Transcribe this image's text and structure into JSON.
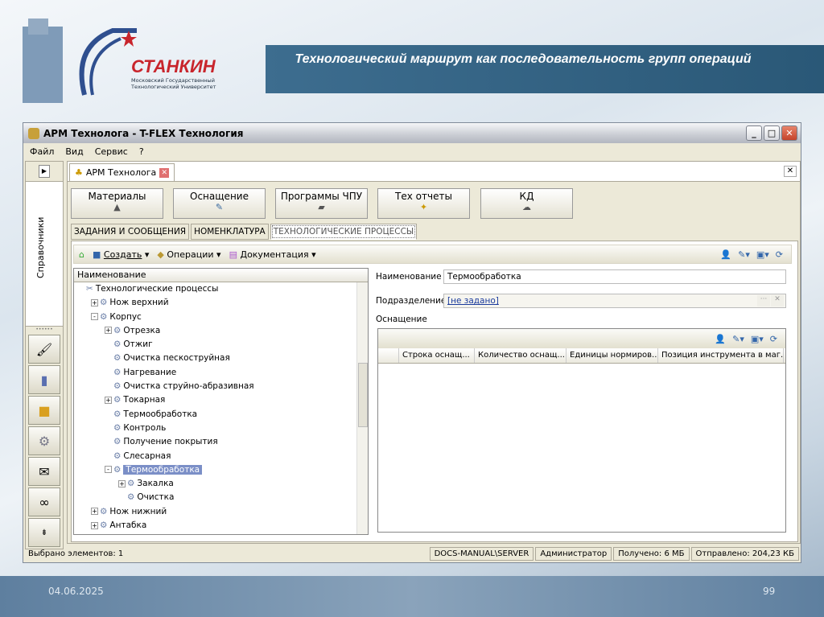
{
  "slide": {
    "title": "Технологический маршрут как последовательность групп операций",
    "date": "04.06.2025",
    "page": "99",
    "logo": {
      "name": "СТАНКИН",
      "subtitle": "Московский Государственный Технологический Университет"
    }
  },
  "window": {
    "title": "АРМ Технолога - T-FLEX Технология",
    "menu": [
      "Файл",
      "Вид",
      "Сервис",
      "?"
    ],
    "sidebar": {
      "label": "Справочники",
      "buttons": [
        "brush-icon",
        "database-icon",
        "package-icon",
        "gears-icon",
        "mail-icon",
        "link-icon",
        "collapse-icon"
      ]
    },
    "doc_tab": "АРМ Технолога",
    "big_buttons": [
      "Материалы",
      "Оснащение",
      "Программы ЧПУ",
      "Тех отчеты",
      "КД"
    ],
    "sub_tabs": [
      "ЗАДАНИЯ И СООБЩЕНИЯ",
      "НОМЕНКЛАТУРА",
      "ТЕХНОЛОГИЧЕСКИЕ ПРОЦЕССЫ"
    ],
    "toolbar": {
      "create": "Создать",
      "operations": "Операции",
      "documentation": "Документация"
    },
    "tree": {
      "header": "Наименование",
      "items": [
        {
          "label": "Технологические процессы",
          "level": 0,
          "exp": ""
        },
        {
          "label": "Нож верхний",
          "level": 1,
          "exp": "+"
        },
        {
          "label": "Корпус",
          "level": 1,
          "exp": "-"
        },
        {
          "label": "Отрезка",
          "level": 2,
          "exp": "+"
        },
        {
          "label": "Отжиг",
          "level": 2,
          "exp": ""
        },
        {
          "label": "Очистка пескоструйная",
          "level": 2,
          "exp": ""
        },
        {
          "label": "Нагревание",
          "level": 2,
          "exp": ""
        },
        {
          "label": "Очистка струйно-абразивная",
          "level": 2,
          "exp": ""
        },
        {
          "label": "Токарная",
          "level": 2,
          "exp": "+"
        },
        {
          "label": "Термообработка",
          "level": 2,
          "exp": ""
        },
        {
          "label": "Контроль",
          "level": 2,
          "exp": ""
        },
        {
          "label": "Получение покрытия",
          "level": 2,
          "exp": ""
        },
        {
          "label": "Слесарная",
          "level": 2,
          "exp": ""
        },
        {
          "label": "Термообработка",
          "level": 2,
          "exp": "-",
          "selected": true
        },
        {
          "label": "Закалка",
          "level": 3,
          "exp": "+"
        },
        {
          "label": "Очистка",
          "level": 3,
          "exp": ""
        },
        {
          "label": "Нож нижний",
          "level": 1,
          "exp": "+"
        },
        {
          "label": "Антабка",
          "level": 1,
          "exp": "+"
        }
      ]
    },
    "details": {
      "name_label": "Наименование",
      "name_value": "Термообработка",
      "division_label": "Подразделение",
      "division_value": "[не задано]",
      "equipment_label": "Оснащение",
      "columns": [
        "Строка оснащ...",
        "Количество оснащ...",
        "Единицы нормиров...",
        "Позиция инструмента в маг..."
      ]
    },
    "status": {
      "selected": "Выбрано элементов: 1",
      "server": "DOCS-MANUAL\\SERVER",
      "user": "Администратор",
      "received": "Получено: 6 МБ",
      "sent": "Отправлено: 204,23 КБ"
    }
  }
}
